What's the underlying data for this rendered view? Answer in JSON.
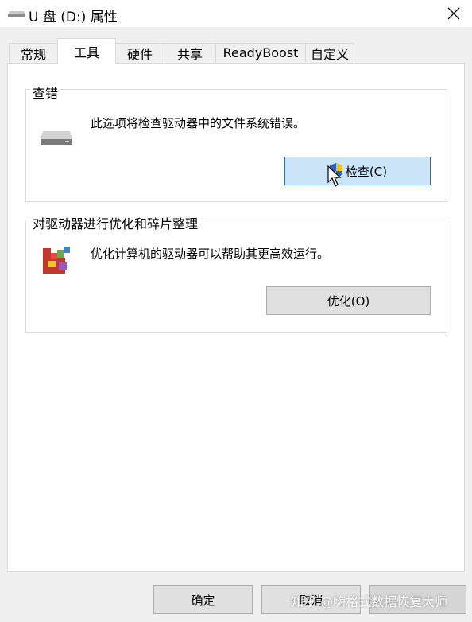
{
  "window": {
    "title": "U 盘 (D:) 属性",
    "close_icon": "close-icon"
  },
  "tabs": [
    {
      "label": "常规"
    },
    {
      "label": "工具"
    },
    {
      "label": "硬件"
    },
    {
      "label": "共享"
    },
    {
      "label": "ReadyBoost"
    },
    {
      "label": "自定义"
    }
  ],
  "active_tab": "工具",
  "error_check": {
    "title": "查错",
    "description": "此选项将检查驱动器中的文件系统错误。",
    "button_label": "检查(C)"
  },
  "optimize": {
    "title": "对驱动器进行优化和碎片整理",
    "description": "优化计算机的驱动器可以帮助其更高效运行。",
    "button_label": "优化(O)"
  },
  "footer": {
    "ok_label": "确定",
    "cancel_label": "取消"
  },
  "watermark": "知乎 @嗨格式数据恢复大师",
  "colors": {
    "focus_button": "#cce4f7",
    "focus_border": "#2b6fb3",
    "panel_bg": "#ffffff",
    "window_bg": "#f0f0f0"
  }
}
